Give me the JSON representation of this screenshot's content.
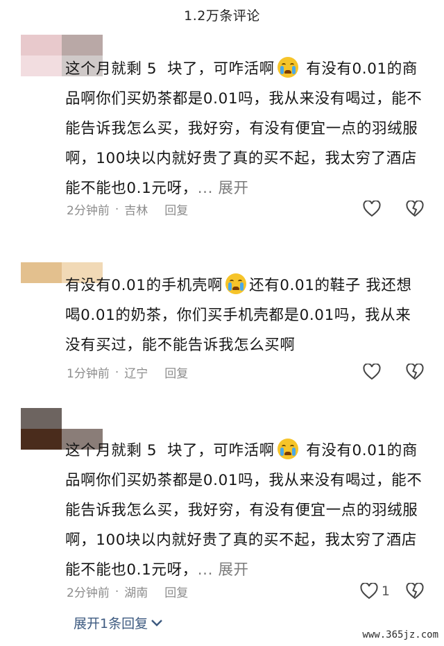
{
  "header": {
    "title": "1.2万条评论"
  },
  "comments": [
    {
      "text_before": "这个月就剩 5  块了，可咋活啊",
      "text_after": " 有没有0.01的商品啊你们买奶茶都是0.01吗，我从来没有喝过，能不能告诉我怎么买，我好穷，有没有便宜一点的羽绒服啊，100块以内就好贵了真的买不起，我太穷了酒店能不能也0.1元呀，",
      "more": "... 展开",
      "time": "2分钟前",
      "location": "吉林",
      "reply": "回复",
      "likes": "",
      "emoji": "crying-face-icon",
      "avatar_colors": [
        "#e8c9cc",
        "#b9a8a6",
        "#f2dde0",
        "#cfc9c8"
      ]
    },
    {
      "text_before": "有没有0.01的手机壳啊",
      "text_after": "还有0.01的鞋子 我还想喝0.01的奶茶，你们买手机壳都是0.01吗，我从来没有买过，能不能告诉我怎么买啊",
      "more": "",
      "time": "1分钟前",
      "location": "辽宁",
      "reply": "回复",
      "likes": "",
      "emoji": "crying-face-icon",
      "avatar_colors": [
        "#e3c08e",
        "#f1d9b6",
        "#ffffff",
        "#ffffff"
      ]
    },
    {
      "text_before": "这个月就剩 5  块了，可咋活啊",
      "text_after": " 有没有0.01的商品啊你们买奶茶都是0.01吗，我从来没有喝过，能不能告诉我怎么买，我好穷，有没有便宜一点的羽绒服啊，100块以内就好贵了真的买不起，我太穷了酒店能不能也0.1元呀，",
      "more": "... 展开",
      "time": "2分钟前",
      "location": "湖南",
      "reply": "回复",
      "likes": "1",
      "emoji": "crying-face-icon",
      "avatar_colors": [
        "#6d6460",
        "#ffffff",
        "#4a2c1c",
        "#8a7d78"
      ]
    }
  ],
  "expand_replies": "展开1条回复",
  "watermark": "www.365jz.com"
}
